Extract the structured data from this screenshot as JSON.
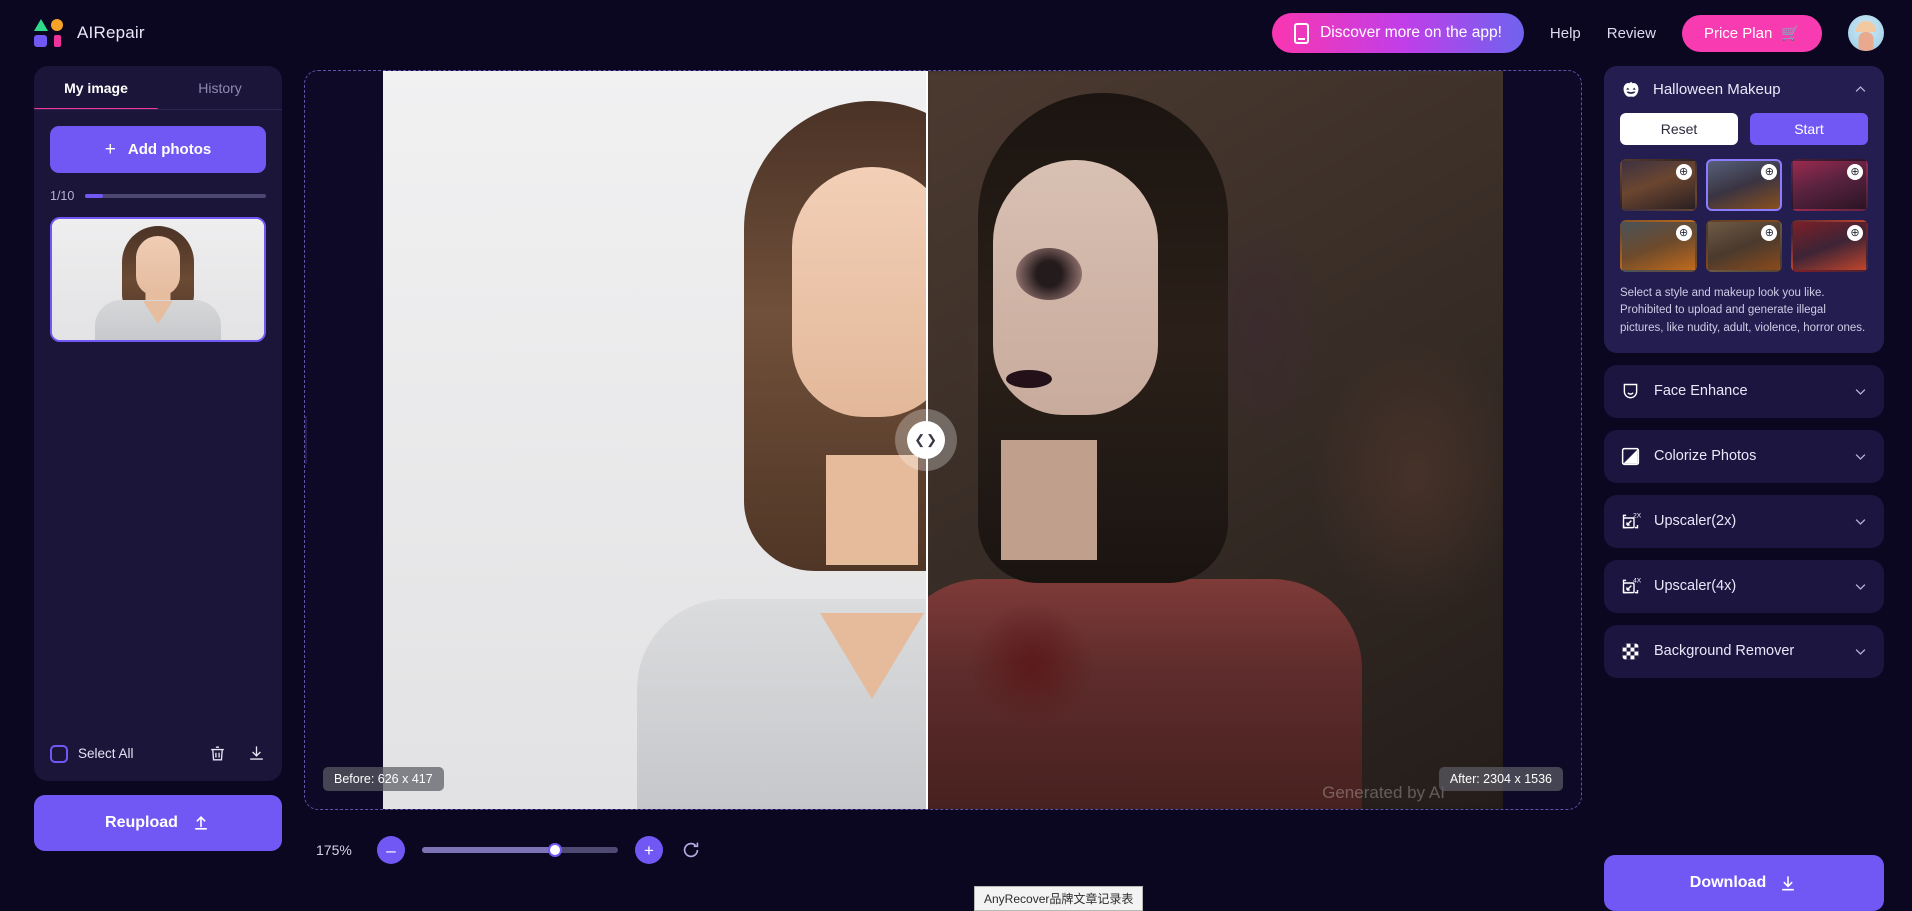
{
  "app": {
    "brand_name": "AIRepair",
    "logo_colors": {
      "triangle": "#2fdb8a",
      "circle": "#f6a327",
      "square": "#7158f5",
      "rect": "#f0339c"
    }
  },
  "header": {
    "discover_label": "Discover more on the app!",
    "discover_icon": "phone-icon",
    "help_label": "Help",
    "review_label": "Review",
    "price_plan_label": "Price Plan",
    "cart_icon": "🛒",
    "avatar_icon": "user-avatar"
  },
  "sidebar": {
    "tabs": [
      {
        "label": "My image",
        "active": true
      },
      {
        "label": "History",
        "active": false
      }
    ],
    "add_photos_label": "Add photos",
    "add_photos_icon": "plus-icon",
    "counter_label": "1/10",
    "counter_percent": 10,
    "select_all_label": "Select All",
    "delete_icon": "trash-icon",
    "download_icon": "download-icon",
    "reupload_label": "Reupload",
    "reupload_icon": "upload-icon",
    "thumbnail_alt": "portrait-thumbnail"
  },
  "canvas": {
    "before_badge": "Before: 626 x 417",
    "after_badge": "After: 2304 x 1536",
    "watermark": "Generated by AI",
    "slider_icon": "compare-slider-handle",
    "collapse_icon": "chevron-left-icon"
  },
  "zoom": {
    "percent_label": "175%",
    "minus_label": "–",
    "plus_label": "+",
    "fill_percent": 68,
    "reset_icon": "refresh-icon"
  },
  "tooltip": {
    "text": "AnyRecover品牌文章记录表"
  },
  "right_panel": {
    "halloween": {
      "title": "Halloween Makeup",
      "icon": "pumpkin-icon",
      "expanded": true,
      "chevron": "chevron-up-icon",
      "reset_label": "Reset",
      "start_label": "Start",
      "note": "Select a style and makeup look you like. Prohibited to upload and generate illegal pictures, like nudity, adult, violence, horror ones.",
      "styles": [
        {
          "name": "witch-pumpkin-night",
          "selected": false,
          "zoom_icon": "zoom-in-icon"
        },
        {
          "name": "skull-face-archway",
          "selected": true,
          "zoom_icon": "zoom-in-icon"
        },
        {
          "name": "neon-street-zombie",
          "selected": false,
          "zoom_icon": "zoom-in-icon"
        },
        {
          "name": "witch-hat-lantern",
          "selected": false,
          "zoom_icon": "zoom-in-icon"
        },
        {
          "name": "autumn-graveyard",
          "selected": false,
          "zoom_icon": "zoom-in-icon"
        },
        {
          "name": "red-floral-witch",
          "selected": false,
          "zoom_icon": "zoom-in-icon"
        }
      ]
    },
    "tools": [
      {
        "label": "Face Enhance",
        "icon": "face-mask-icon",
        "chevron": "chevron-down-icon"
      },
      {
        "label": "Colorize Photos",
        "icon": "color-split-icon",
        "chevron": "chevron-down-icon"
      },
      {
        "label": "Upscaler(2x)",
        "icon": "upscale-2x-icon",
        "chevron": "chevron-down-icon"
      },
      {
        "label": "Upscaler(4x)",
        "icon": "upscale-4x-icon",
        "chevron": "chevron-down-icon"
      },
      {
        "label": "Background Remover",
        "icon": "checkerboard-icon",
        "chevron": "chevron-down-icon"
      }
    ],
    "download_label": "Download",
    "download_icon": "download-icon"
  }
}
